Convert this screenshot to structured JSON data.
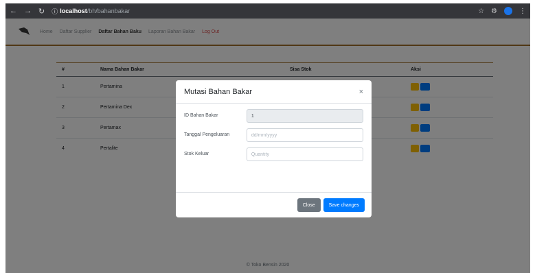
{
  "browser": {
    "url_host": "localhost",
    "url_path": "/bh/bahanbakar"
  },
  "navbar": {
    "links": [
      {
        "label": "Home"
      },
      {
        "label": "Daftar Supplier"
      },
      {
        "label": "Daftar Bahan Baku"
      },
      {
        "label": "Laporan Bahan Bakar"
      },
      {
        "label": "Log Out"
      }
    ]
  },
  "table": {
    "headers": [
      "#",
      "Nama Bahan Bakar",
      "Sisa Stok",
      "Aksi"
    ],
    "rows": [
      {
        "no": "1",
        "name": "Pertamina"
      },
      {
        "no": "2",
        "name": "Pertamina Dex"
      },
      {
        "no": "3",
        "name": "Pertamax"
      },
      {
        "no": "4",
        "name": "Pertalite"
      }
    ]
  },
  "footer": {
    "text": "© Toko Bensin 2020"
  },
  "modal": {
    "title": "Mutasi Bahan Bakar",
    "close": "×",
    "fields": {
      "id_label": "ID Bahan Bakar",
      "id_value": "1",
      "date_label": "Tanggal Pengeluaran",
      "date_placeholder": "dd/mm/yyyy",
      "stock_label": "Stok Keluar",
      "stock_placeholder": "Quantity"
    },
    "close_button": "Close",
    "save_button": "Save changes"
  },
  "colors": {
    "accent": "#a0702a",
    "primary": "#007bff",
    "warning": "#ffc107",
    "secondary": "#6c757d"
  }
}
